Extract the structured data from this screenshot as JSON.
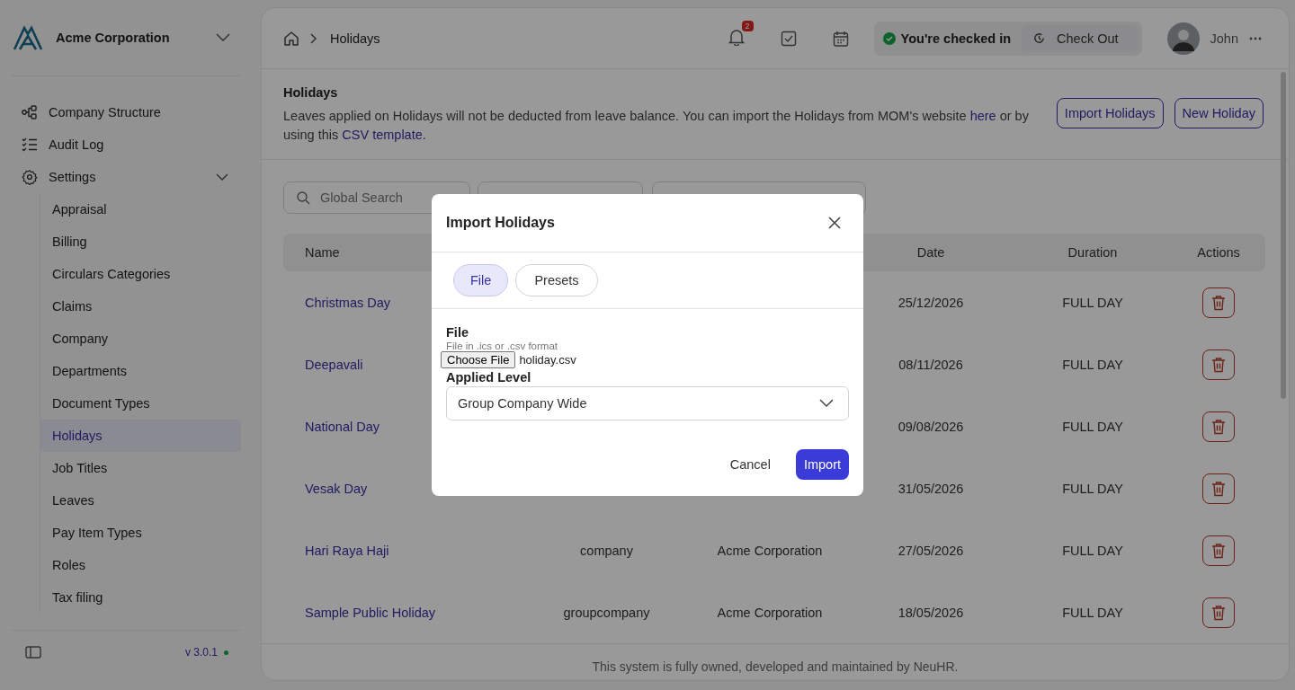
{
  "sidebar": {
    "company": "Acme Corporation",
    "items": [
      {
        "label": "Company Structure"
      },
      {
        "label": "Audit Log"
      },
      {
        "label": "Settings",
        "expanded": true,
        "children": [
          {
            "label": "Appraisal",
            "selected": false
          },
          {
            "label": "Billing",
            "selected": false
          },
          {
            "label": "Circulars Categories",
            "selected": false
          },
          {
            "label": "Claims",
            "selected": false
          },
          {
            "label": "Company",
            "selected": false
          },
          {
            "label": "Departments",
            "selected": false
          },
          {
            "label": "Document Types",
            "selected": false
          },
          {
            "label": "Holidays",
            "selected": true
          },
          {
            "label": "Job Titles",
            "selected": false
          },
          {
            "label": "Leaves",
            "selected": false
          },
          {
            "label": "Pay Item Types",
            "selected": false
          },
          {
            "label": "Roles",
            "selected": false
          },
          {
            "label": "Tax filing",
            "selected": false
          }
        ]
      }
    ],
    "version": "v 3.0.1"
  },
  "header": {
    "breadcrumb": "Holidays",
    "notification_count": "2",
    "check_status": "You're checked in",
    "check_out": "Check Out",
    "user": "John"
  },
  "page": {
    "title": "Holidays",
    "description_before": "Leaves applied on Holidays will not be deducted from leave balance. You can import the Holidays from MOM's website ",
    "link_here": "here",
    "description_middle": " or by using this ",
    "link_template": "CSV template",
    "description_end": ".",
    "buttons": [
      "Import Holidays",
      "New Holiday"
    ]
  },
  "search": {
    "placeholder": "Global Search"
  },
  "table": {
    "columns": [
      "Name",
      "Date",
      "Duration",
      "Actions"
    ],
    "rows": [
      {
        "name": "Christmas Day",
        "date": "25/12/2026",
        "duration": "FULL DAY"
      },
      {
        "name": "Deepavali",
        "date": "08/11/2026",
        "duration": "FULL DAY"
      },
      {
        "name": "National Day",
        "date": "09/08/2026",
        "duration": "FULL DAY"
      },
      {
        "name": "Vesak Day",
        "date": "31/05/2026",
        "duration": "FULL DAY"
      },
      {
        "name": "Hari Raya Haji",
        "type": "company",
        "company": "Acme Corporation",
        "date": "27/05/2026",
        "duration": "FULL DAY"
      },
      {
        "name": "Sample Public Holiday",
        "type": "groupcompany",
        "company": "Acme Corporation",
        "date": "18/05/2026",
        "duration": "FULL DAY"
      }
    ]
  },
  "footer": "This system is fully owned, developed and maintained by NeuHR.",
  "dialog": {
    "title": "Import Holidays",
    "tabs": [
      {
        "label": "File",
        "selected": true
      },
      {
        "label": "Presets",
        "selected": false
      }
    ],
    "file_label": "File",
    "file_hint": "File in .ics or .csv format",
    "choose_file": "Choose File",
    "file_name": "holiday.csv",
    "level_label": "Applied Level",
    "level_value": "Group Company Wide",
    "buttons": [
      "Cancel",
      "Import"
    ]
  }
}
